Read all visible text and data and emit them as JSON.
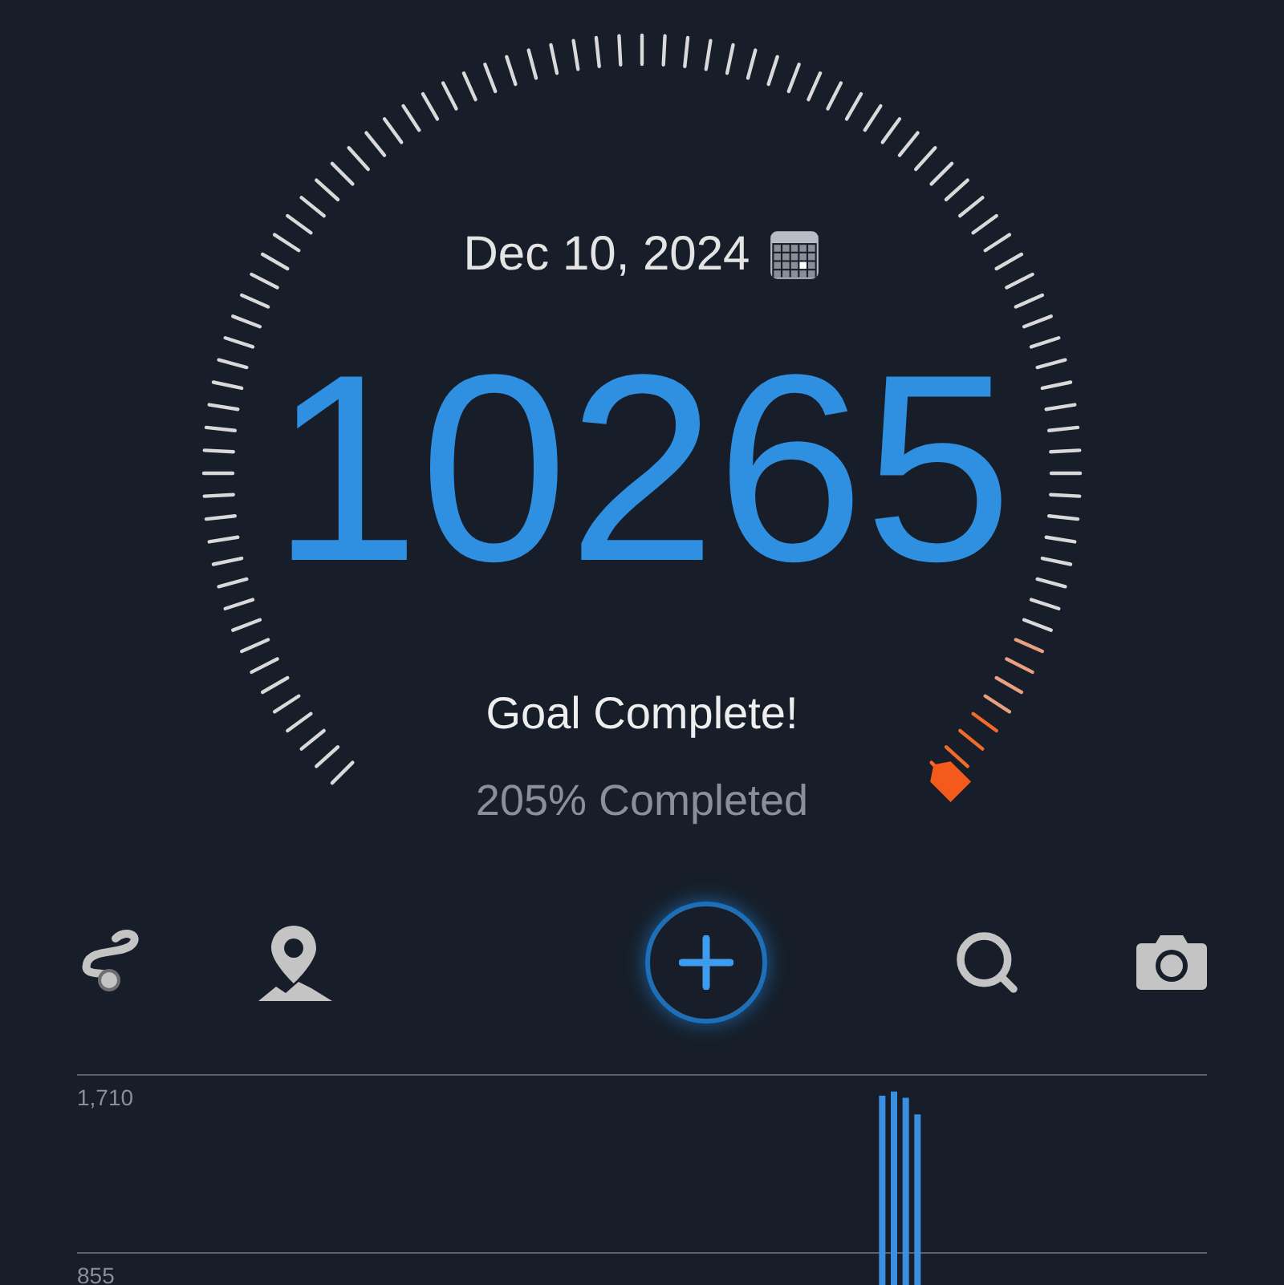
{
  "date": "Dec 10, 2024",
  "steps": "10265",
  "goal_status": "Goal Complete!",
  "completion": "205% Completed",
  "toolbar": [
    {
      "kind": "route"
    },
    {
      "kind": "map"
    },
    {
      "kind": "add"
    },
    {
      "kind": "search"
    },
    {
      "kind": "camera"
    }
  ],
  "chart_data": {
    "type": "bar",
    "ylim": [
      0,
      1710
    ],
    "yticks": [
      {
        "value": 855,
        "label": "855"
      },
      {
        "value": 1710,
        "label": "1,710"
      }
    ],
    "values": [
      null,
      null,
      null,
      null,
      null,
      null,
      null,
      null,
      null,
      null,
      null,
      null,
      null,
      null,
      null,
      null,
      null,
      null,
      null,
      null,
      null,
      null,
      null,
      null,
      null,
      null,
      null,
      null,
      null,
      null,
      null,
      null,
      null,
      null,
      null,
      null,
      null,
      null,
      null,
      null,
      null,
      null,
      null,
      null,
      null,
      null,
      null,
      null,
      null,
      null,
      null,
      null,
      null,
      null,
      null,
      null,
      null,
      null,
      null,
      null,
      null,
      null,
      null,
      null,
      null,
      null,
      null,
      null,
      1610,
      1630,
      1600,
      1520,
      null,
      null,
      null,
      null,
      null,
      null,
      null,
      null,
      null,
      null,
      null,
      null,
      null,
      null,
      null,
      null,
      null,
      null,
      null,
      null,
      null,
      null,
      null,
      null
    ]
  }
}
